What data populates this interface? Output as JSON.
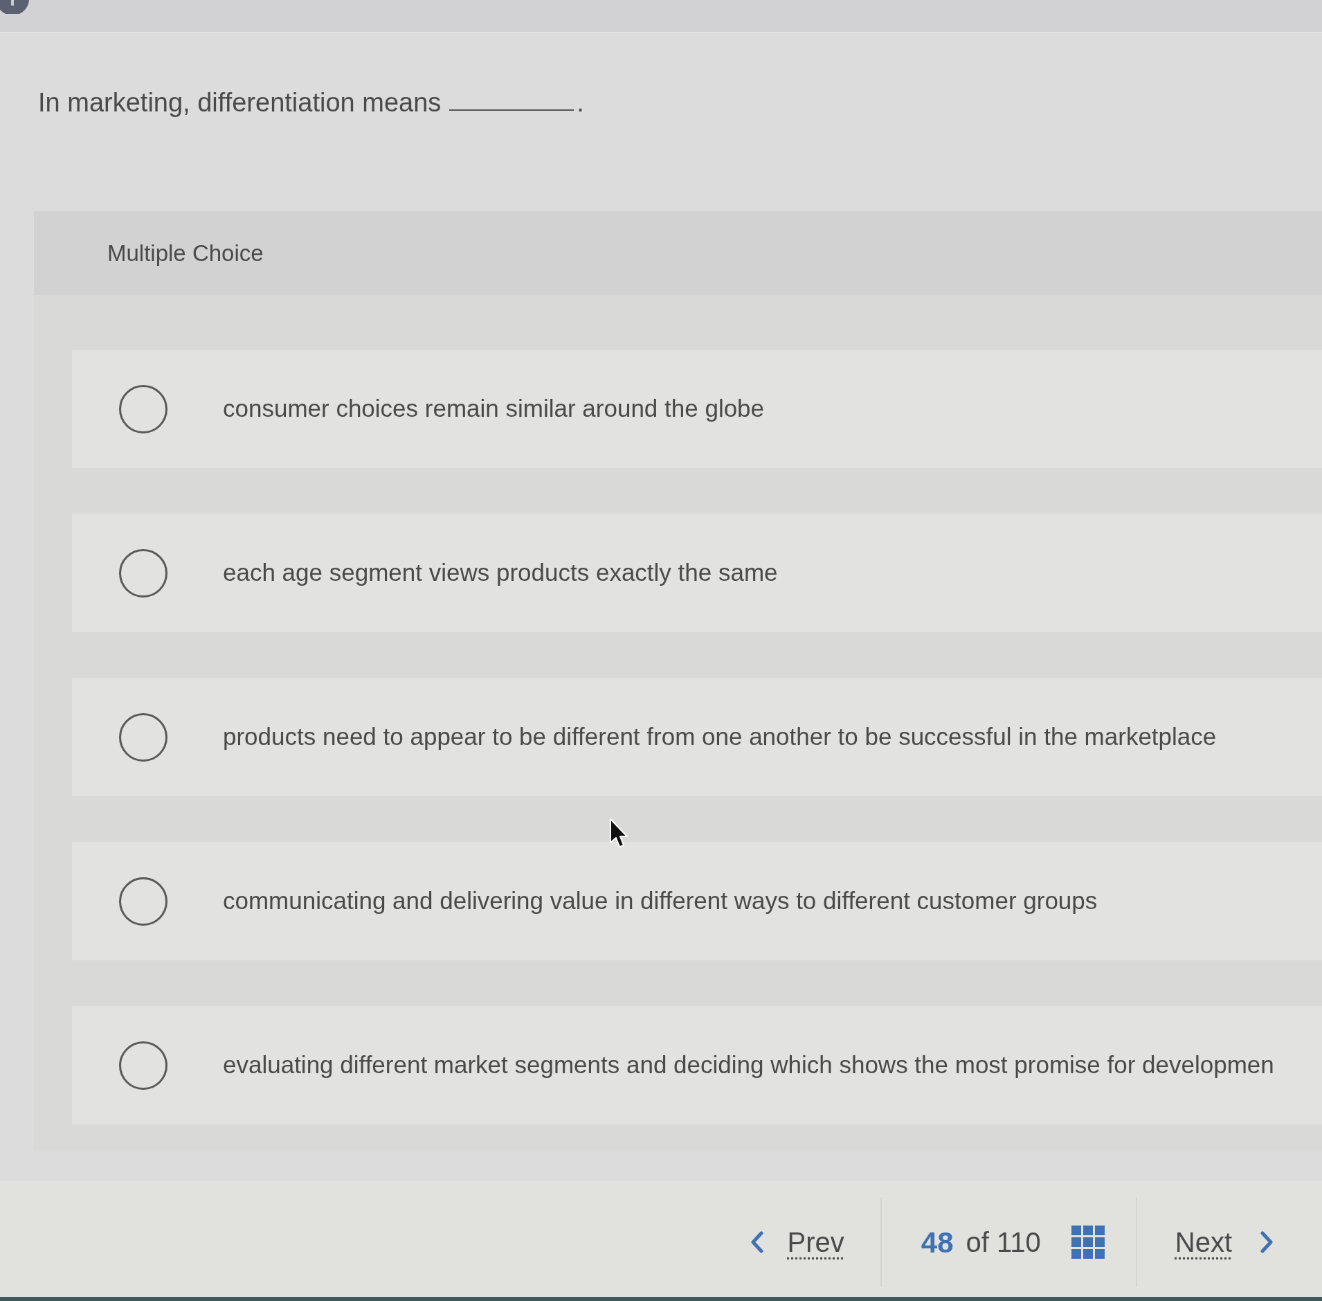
{
  "question": {
    "text": "In marketing, differentiation means",
    "end": "."
  },
  "answer_panel": {
    "heading": "Multiple Choice",
    "options": [
      {
        "text": "consumer choices remain similar around the globe",
        "selected": false
      },
      {
        "text": "each age segment views products exactly the same",
        "selected": false
      },
      {
        "text": "products need to appear to be different from one another to be successful in the marketplace",
        "selected": false
      },
      {
        "text": "communicating and delivering value in different ways to different customer groups",
        "selected": false
      },
      {
        "text": "evaluating different market segments and deciding which shows the most promise for developmen",
        "selected": false
      }
    ]
  },
  "navigation": {
    "prev": "Prev",
    "current": "48",
    "total": "of 110",
    "next": "Next"
  }
}
